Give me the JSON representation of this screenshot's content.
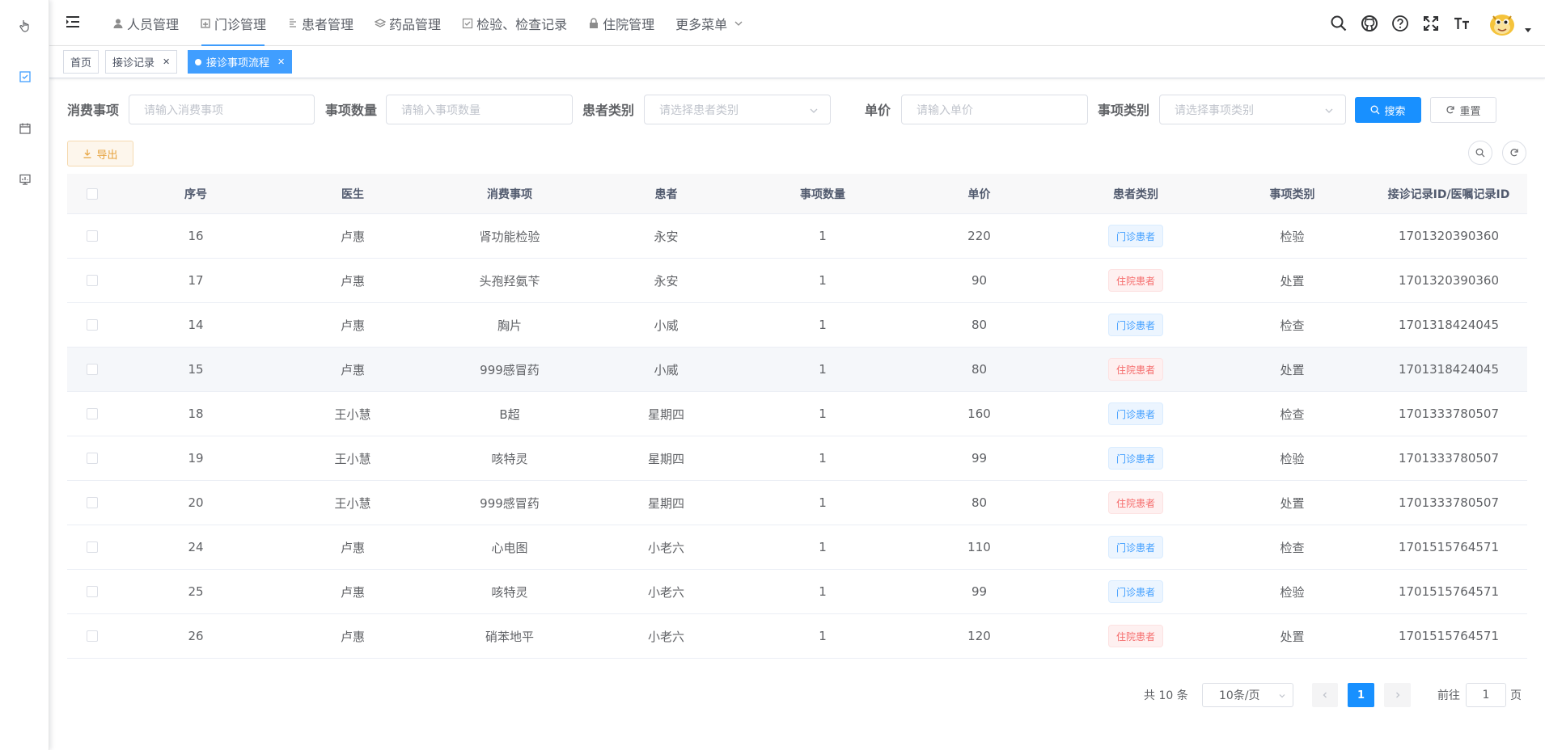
{
  "colors": {
    "primary": "#1890ff",
    "warning": "#e6a23c",
    "danger": "#f56c6c",
    "info_blue": "#409eff"
  },
  "sidebar": {
    "icons": [
      "hand-pointer-icon",
      "checkbox-icon",
      "calendar-icon",
      "monitor-icon"
    ]
  },
  "navbar": {
    "menu": [
      {
        "label": "人员管理",
        "icon": "user-icon"
      },
      {
        "label": "门诊管理",
        "icon": "clinic-icon",
        "active": true
      },
      {
        "label": "患者管理",
        "icon": "patient-icon"
      },
      {
        "label": "药品管理",
        "icon": "medicine-icon"
      },
      {
        "label": "检验、检查记录",
        "icon": "check-icon"
      },
      {
        "label": "住院管理",
        "icon": "lock-icon"
      },
      {
        "label": "更多菜单",
        "icon": "chevron-down-icon"
      }
    ],
    "right_icons": [
      "search-icon",
      "github-icon",
      "help-icon",
      "fullscreen-icon",
      "font-size-icon"
    ]
  },
  "tags": [
    {
      "label": "首页"
    },
    {
      "label": "接诊记录"
    },
    {
      "label": "接诊事项流程",
      "active": true
    }
  ],
  "form": {
    "fields": [
      {
        "label": "消费事项",
        "placeholder": "请输入消费事项"
      },
      {
        "label": "事项数量",
        "placeholder": "请输入事项数量"
      },
      {
        "label": "患者类别",
        "placeholder": "请选择患者类别"
      },
      {
        "label": "单价",
        "placeholder": "请输入单价"
      },
      {
        "label": "事项类别",
        "placeholder": "请选择事项类别"
      }
    ],
    "search_label": "搜索",
    "reset_label": "重置",
    "export_label": "导出"
  },
  "table": {
    "headers": [
      "序号",
      "医生",
      "消费事项",
      "患者",
      "事项数量",
      "单价",
      "患者类别",
      "事项类别",
      "接诊记录ID/医嘱记录ID"
    ],
    "rows": [
      {
        "id": "16",
        "doctor": "卢惠",
        "item": "肾功能检验",
        "patient": "永安",
        "qty": "1",
        "price": "220",
        "ptype": "门诊患者",
        "itype": "检验",
        "rid": "1701320390360"
      },
      {
        "id": "17",
        "doctor": "卢惠",
        "item": "头孢羟氨苄",
        "patient": "永安",
        "qty": "1",
        "price": "90",
        "ptype": "住院患者",
        "itype": "处置",
        "rid": "1701320390360"
      },
      {
        "id": "14",
        "doctor": "卢惠",
        "item": "胸片",
        "patient": "小威",
        "qty": "1",
        "price": "80",
        "ptype": "门诊患者",
        "itype": "检查",
        "rid": "1701318424045"
      },
      {
        "id": "15",
        "doctor": "卢惠",
        "item": "999感冒药",
        "patient": "小威",
        "qty": "1",
        "price": "80",
        "ptype": "住院患者",
        "itype": "处置",
        "rid": "1701318424045"
      },
      {
        "id": "18",
        "doctor": "王小慧",
        "item": "B超",
        "patient": "星期四",
        "qty": "1",
        "price": "160",
        "ptype": "门诊患者",
        "itype": "检查",
        "rid": "1701333780507"
      },
      {
        "id": "19",
        "doctor": "王小慧",
        "item": "咳特灵",
        "patient": "星期四",
        "qty": "1",
        "price": "99",
        "ptype": "门诊患者",
        "itype": "检验",
        "rid": "1701333780507"
      },
      {
        "id": "20",
        "doctor": "王小慧",
        "item": "999感冒药",
        "patient": "星期四",
        "qty": "1",
        "price": "80",
        "ptype": "住院患者",
        "itype": "处置",
        "rid": "1701333780507"
      },
      {
        "id": "24",
        "doctor": "卢惠",
        "item": "心电图",
        "patient": "小老六",
        "qty": "1",
        "price": "110",
        "ptype": "门诊患者",
        "itype": "检查",
        "rid": "1701515764571"
      },
      {
        "id": "25",
        "doctor": "卢惠",
        "item": "咳特灵",
        "patient": "小老六",
        "qty": "1",
        "price": "99",
        "ptype": "门诊患者",
        "itype": "检验",
        "rid": "1701515764571"
      },
      {
        "id": "26",
        "doctor": "卢惠",
        "item": "硝苯地平",
        "patient": "小老六",
        "qty": "1",
        "price": "120",
        "ptype": "住院患者",
        "itype": "处置",
        "rid": "1701515764571"
      }
    ]
  },
  "pagination": {
    "total": "共 10 条",
    "page_size": "10条/页",
    "current_page": "1",
    "goto_prefix": "前往",
    "goto_value": "1",
    "goto_suffix": "页"
  }
}
